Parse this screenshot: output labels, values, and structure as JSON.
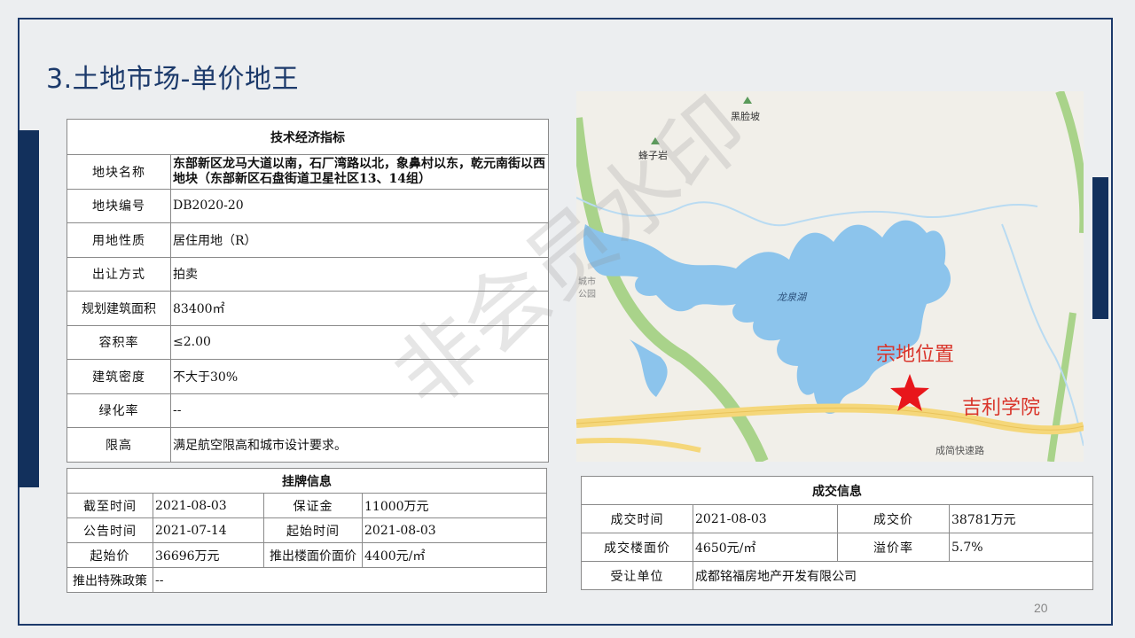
{
  "title": "3.土地市场-单价地王",
  "page_number": "20",
  "watermark": "非会员水印",
  "tech": {
    "header": "技术经济指标",
    "rows": [
      {
        "label": "地块名称",
        "value": "东部新区龙马大道以南，石厂湾路以北，象鼻村以东，乾元南街以西地块（东部新区石盘街道卫星社区13、14组）"
      },
      {
        "label": "地块编号",
        "value": "DB2020-20"
      },
      {
        "label": "用地性质",
        "value": "居住用地（R）"
      },
      {
        "label": "出让方式",
        "value": "拍卖"
      },
      {
        "label": "规划建筑面积",
        "value": "83400㎡"
      },
      {
        "label": "容积率",
        "value": "≤2.00"
      },
      {
        "label": "建筑密度",
        "value": "不大于30%"
      },
      {
        "label": "绿化率",
        "value": "--"
      },
      {
        "label": "限高",
        "value": "满足航空限高和城市设计要求。"
      }
    ]
  },
  "listing": {
    "header": "挂牌信息",
    "r1": {
      "l1": "截至时间",
      "v1": "2021-08-03",
      "l2": "保证金",
      "v2": "11000万元"
    },
    "r2": {
      "l1": "公告时间",
      "v1": "2021-07-14",
      "l2": "起始时间",
      "v2": "2021-08-03"
    },
    "r3": {
      "l1": "起始价",
      "v1": "36696万元",
      "l2": "推出楼面价面价",
      "v2": "4400元/㎡"
    },
    "r4": {
      "l1": "推出特殊政策",
      "v1": "--"
    }
  },
  "deal": {
    "header": "成交信息",
    "r1": {
      "l1": "成交时间",
      "v1": "2021-08-03",
      "l2": "成交价",
      "v2": "38781万元"
    },
    "r2": {
      "l1": "成交楼面价",
      "v1": "4650元/㎡",
      "l2": "溢价率",
      "v2": "5.7%"
    },
    "r3": {
      "l1": "受让单位",
      "v1": "成都铭福房地产开发有限公司"
    }
  },
  "map": {
    "labels": {
      "heilianpo": "黑脸坡",
      "fengziyan": "蜂子岩",
      "longquanhu": "龙泉湖",
      "chengshi": "城市",
      "gongyuan": "公园",
      "site": "宗地位置",
      "college": "吉利学院",
      "expressway": "成简快速路"
    },
    "colors": {
      "water": "#8cc4ec",
      "road": "#f5d77a",
      "green": "#a9d38a",
      "marker": "#e8161b",
      "label": "#d9352b"
    },
    "marker_icon": "star-icon"
  }
}
